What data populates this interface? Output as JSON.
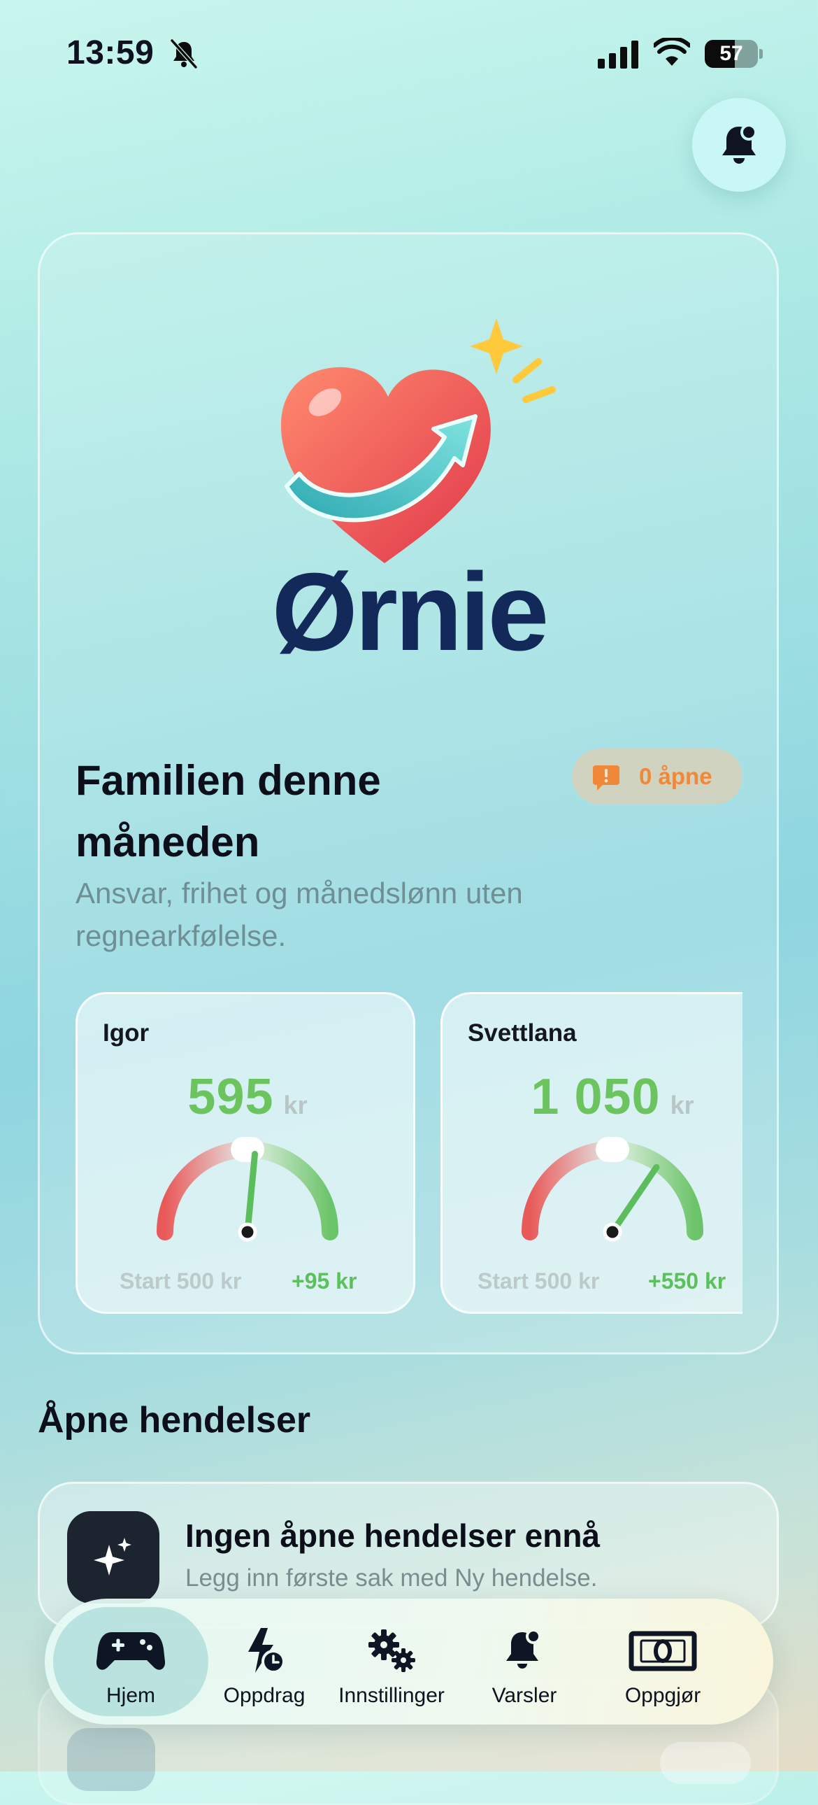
{
  "status_bar": {
    "time": "13:59",
    "battery": "57",
    "battery_level": 0.57
  },
  "brand": {
    "name": "Ørnie"
  },
  "summary": {
    "title": "Familien denne måneden",
    "subtitle": "Ansvar, frihet og månedslønn uten regnearkfølelse.",
    "open_badge": "0 åpne"
  },
  "kids": [
    {
      "name": "Igor",
      "amount": "595",
      "unit": "kr",
      "start": "Start 500 kr",
      "delta": "+95 kr",
      "gauge_level": 0.53
    },
    {
      "name": "Svettlana",
      "amount": "1 050",
      "unit": "kr",
      "start": "Start 500 kr",
      "delta": "+550 kr",
      "gauge_level": 0.69
    }
  ],
  "events": {
    "section_title": "Åpne hendelser",
    "empty_title": "Ingen åpne hendelser ennå",
    "empty_subtitle": "Legg inn første sak med Ny hendelse."
  },
  "tabs": [
    {
      "label": "Hjem",
      "icon": "gamepad-icon",
      "active": true
    },
    {
      "label": "Oppdrag",
      "icon": "bolt-clock-icon",
      "active": false
    },
    {
      "label": "Innstillinger",
      "icon": "gears-icon",
      "active": false
    },
    {
      "label": "Varsler",
      "icon": "bell-badge-icon",
      "active": false
    },
    {
      "label": "Oppgjør",
      "icon": "banknote-icon",
      "active": false
    }
  ],
  "colors": {
    "accent_green": "#6cc45e",
    "badge_orange": "#f0883a",
    "brand_navy": "#13295a"
  }
}
